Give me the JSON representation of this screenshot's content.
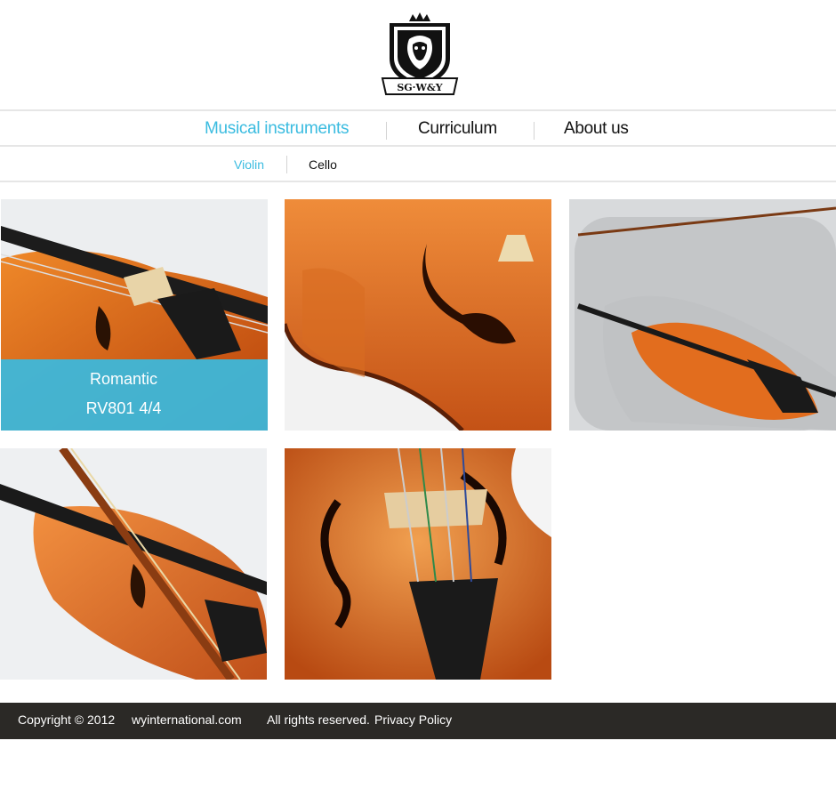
{
  "brand": {
    "logo_text": "SG·W&Y",
    "accent_color": "#3bbce0",
    "footer_bg": "#2b2926"
  },
  "nav": {
    "items": [
      {
        "label": "Musical instruments",
        "active": true
      },
      {
        "label": "Curriculum",
        "active": false
      },
      {
        "label": "About us",
        "active": false
      }
    ]
  },
  "subnav": {
    "items": [
      {
        "label": "Violin",
        "active": true
      },
      {
        "label": "Cello",
        "active": false
      }
    ]
  },
  "products": {
    "items": [
      {
        "image": "violin-closeup-bridge",
        "caption_line1": "Romantic",
        "caption_line2": "RV801 4/4",
        "hovered": true
      },
      {
        "image": "violin-f-hole-detail",
        "hovered": false
      },
      {
        "image": "violin-in-case",
        "hovered": false
      },
      {
        "image": "violin-with-bow",
        "hovered": false
      },
      {
        "image": "violin-tailpiece-closeup",
        "hovered": false
      }
    ]
  },
  "footer": {
    "copyright": "Copyright © 2012",
    "domain": "wyinternational.com",
    "rights": "All rights reserved.",
    "privacy": "Privacy Policy"
  }
}
